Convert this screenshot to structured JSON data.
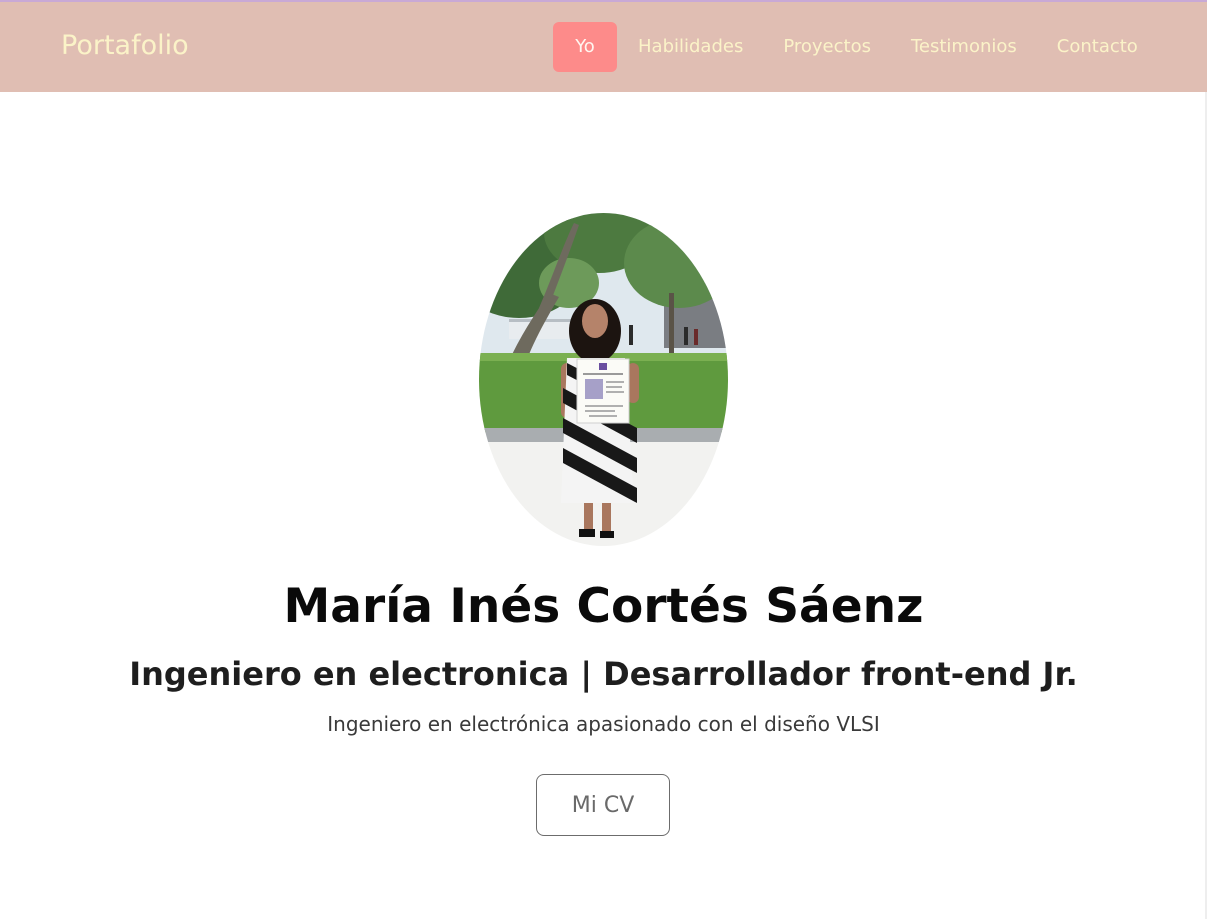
{
  "navbar": {
    "brand": "Portafolio",
    "links": [
      {
        "label": "Yo",
        "active": true
      },
      {
        "label": "Habilidades",
        "active": false
      },
      {
        "label": "Proyectos",
        "active": false
      },
      {
        "label": "Testimonios",
        "active": false
      },
      {
        "label": "Contacto",
        "active": false
      }
    ]
  },
  "hero": {
    "name": "María Inés Cortés Sáenz",
    "title": "Ingeniero en electronica | Desarrollador front-end Jr.",
    "tagline": "Ingeniero en electrónica apasionado con el diseño VLSI",
    "cv_button": "Mi CV"
  },
  "colors": {
    "navbar_bg": "#e0beb3",
    "nav_text": "#fbf3c8",
    "active_bg": "#fd8b8a"
  }
}
